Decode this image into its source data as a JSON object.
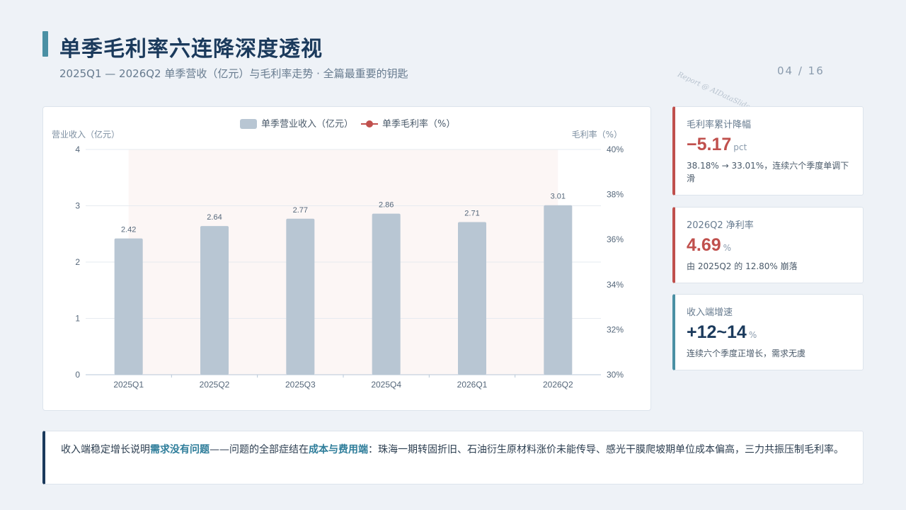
{
  "header": {
    "title": "单季毛利率六连降深度透视",
    "subtitle": "2025Q1 — 2026Q2 单季营收（亿元）与毛利率走势 · 全篇最重要的钥匙",
    "page": "04 / 16",
    "watermark": "Report @ AIDataSlide.com"
  },
  "chart_data": {
    "type": "bar",
    "categories": [
      "2025Q1",
      "2025Q2",
      "2025Q3",
      "2025Q4",
      "2026Q1",
      "2026Q2"
    ],
    "series": [
      {
        "name": "单季营业收入（亿元）",
        "type": "bar",
        "axis": "left",
        "values": [
          2.42,
          2.64,
          2.77,
          2.86,
          2.71,
          3.01
        ],
        "labels": [
          "2.42",
          "2.64",
          "2.77",
          "2.86",
          "2.71",
          "3.01"
        ],
        "color": "#b8c6d3"
      },
      {
        "name": "单季毛利率（%）",
        "type": "line",
        "axis": "right",
        "values": [],
        "color": "#c0504d"
      }
    ],
    "ylabel": "营业收入（亿元）",
    "y2label": "毛利率（%）",
    "ylim": [
      0,
      4
    ],
    "y2lim": [
      30,
      40
    ],
    "yticks": [
      "0",
      "1",
      "2",
      "3",
      "4"
    ],
    "y2ticks": [
      "30%",
      "32%",
      "34%",
      "36%",
      "38%",
      "40%"
    ],
    "legend_position": "top-center",
    "grid": true
  },
  "kpis": [
    {
      "label": "毛利率累计降幅",
      "value": "−5.17",
      "unit": "pct",
      "desc": "38.18% → 33.01%，连续六个季度单调下滑"
    },
    {
      "label": "2026Q2 净利率",
      "value": "4.69",
      "unit": "%",
      "desc": "由 2025Q2 的 12.80% 崩落"
    },
    {
      "label": "收入端增速",
      "value": "+12~14",
      "unit": "%",
      "desc": "连续六个季度正增长，需求无虞"
    }
  ],
  "note": {
    "part1": "收入端稳定增长说明",
    "hl1": "需求没有问题",
    "part2": "——问题的全部症结在",
    "hl2": "成本与费用端",
    "part3": "：珠海一期转固折旧、石油衍生原材料涨价未能传导、感光干膜爬坡期单位成本偏高，三力共振压制毛利率。"
  }
}
